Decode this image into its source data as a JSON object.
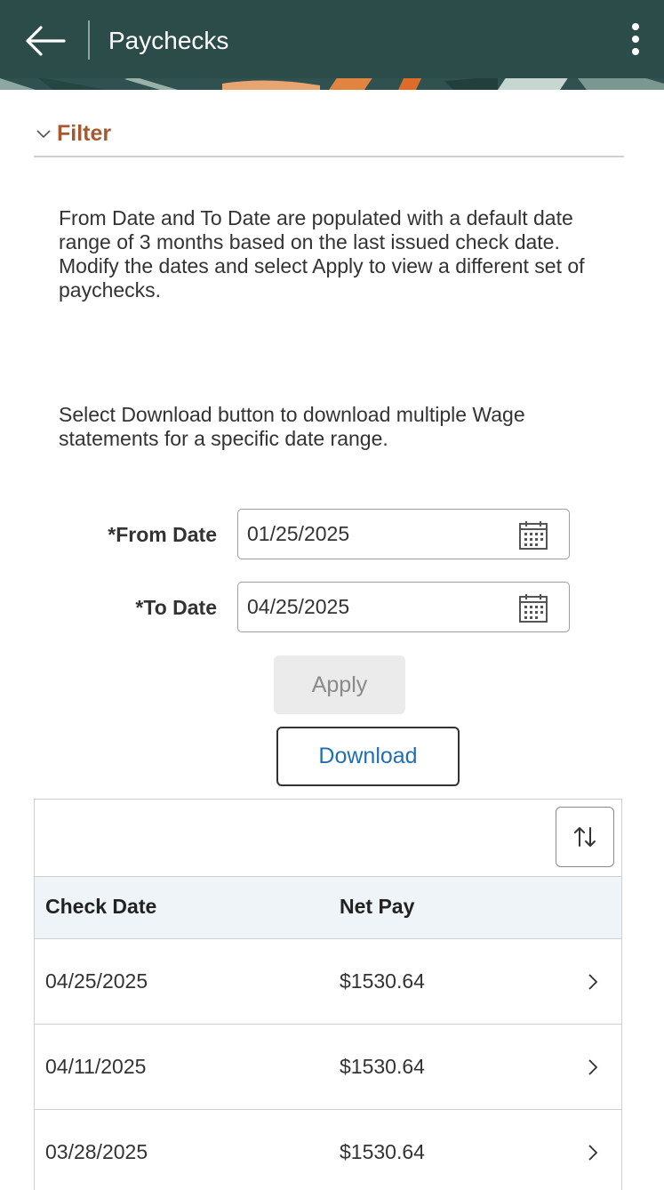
{
  "header": {
    "title": "Paychecks",
    "back_icon": "arrow-left-icon",
    "menu_icon": "kebab-menu-icon",
    "bar_color": "#2b4c49"
  },
  "filter": {
    "toggle_label": "Filter",
    "accent_color": "#a8582f",
    "expanded": true
  },
  "instructions": {
    "p1": "From Date and To Date are populated with a default date range of 3 months based on the last issued check date. Modify the dates and select Apply to view a different set of paychecks.",
    "p2": "Select Download button to download multiple Wage statements for a specific date range."
  },
  "form": {
    "from_label": "*From Date",
    "from_value": "01/25/2025",
    "to_label": "*To Date",
    "to_value": "04/25/2025",
    "calendar_icon": "calendar-icon"
  },
  "actions": {
    "apply_label": "Apply",
    "apply_disabled": true,
    "download_label": "Download",
    "link_color": "#1f6fb4"
  },
  "grid": {
    "sort_icon": "sort-icon",
    "columns": [
      "Check Date",
      "Net Pay"
    ],
    "rows": [
      {
        "check_date": "04/25/2025",
        "net_pay": "$1530.64"
      },
      {
        "check_date": "04/11/2025",
        "net_pay": "$1530.64"
      },
      {
        "check_date": "03/28/2025",
        "net_pay": "$1530.64"
      }
    ]
  }
}
